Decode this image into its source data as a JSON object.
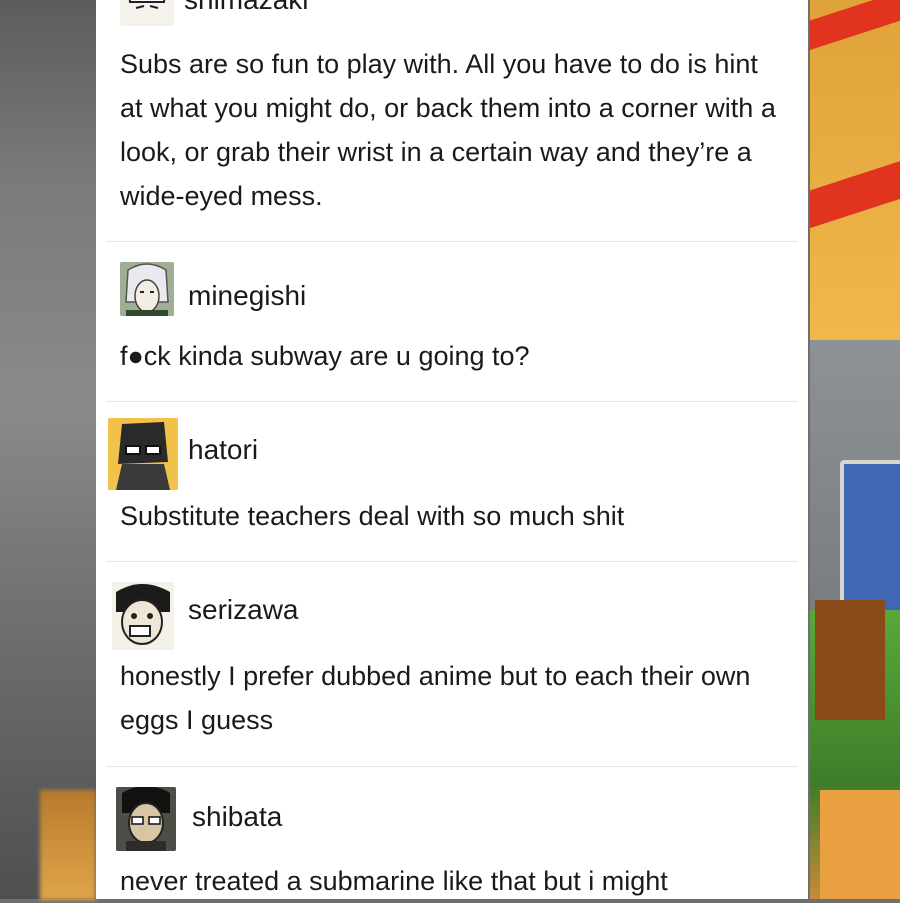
{
  "posts": [
    {
      "username": "shimazaki",
      "text": "Subs are so fun to play with. All you have to do is hint at what you might do, or back them into a corner with a look, or grab their wrist in a certain way and they’re a wide-eyed mess.",
      "avatar": "anime-character-avatar-shimazaki"
    },
    {
      "username": "minegishi",
      "text": "f●ck kinda subway are u going to?",
      "avatar": "anime-character-avatar-minegishi"
    },
    {
      "username": "hatori",
      "text": "Substitute teachers deal with so much shit",
      "avatar": "anime-character-avatar-hatori"
    },
    {
      "username": "serizawa",
      "text": "honestly I prefer dubbed anime but to each their own eggs I guess",
      "avatar": "anime-character-avatar-serizawa"
    },
    {
      "username": "shibata",
      "text": "never treated a submarine like that but i might",
      "avatar": "anime-character-avatar-shibata"
    }
  ]
}
